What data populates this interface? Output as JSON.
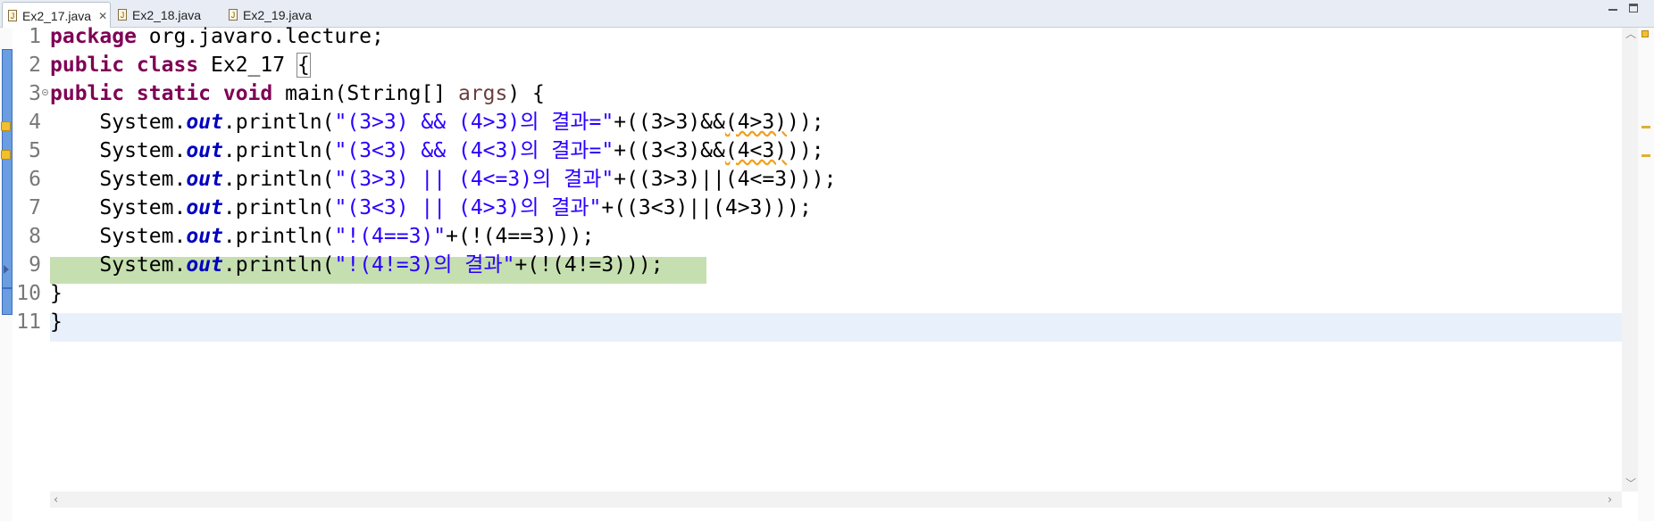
{
  "tabs": [
    {
      "label": "Ex2_17.java",
      "active": true,
      "close": "✕"
    },
    {
      "label": "Ex2_18.java",
      "active": false
    },
    {
      "label": "Ex2_19.java",
      "active": false
    }
  ],
  "line_numbers": [
    "1",
    "2",
    "3",
    "4",
    "5",
    "6",
    "7",
    "8",
    "9",
    "10",
    "11"
  ],
  "code": {
    "l1_kw": "package",
    "l1_rest": " org.javaro.lecture;",
    "l2_kw": "public class",
    "l2_rest": " Ex2_17 ",
    "l2_brace": "{",
    "l3_kw": "public static void",
    "l3_mid": " main(String[] ",
    "l3_param": "args",
    "l3_end": ") {",
    "l4_pre": "    System.",
    "l4_fld": "out",
    "l4_call": ".println(",
    "l4_str": "\"(3>3) && (4>3)의 결과=\"",
    "l4_tail1": "+((3>3)&&",
    "l4_squig": "(4>3)",
    "l4_tail2": "));",
    "l5_pre": "    System.",
    "l5_fld": "out",
    "l5_call": ".println(",
    "l5_str": "\"(3<3) && (4<3)의 결과=\"",
    "l5_tail1": "+((3<3)&&",
    "l5_squig": "(4<3)",
    "l5_tail2": "));",
    "l6_pre": "    System.",
    "l6_fld": "out",
    "l6_call": ".println(",
    "l6_str": "\"(3>3) || (4<=3)의 결과\"",
    "l6_tail": "+((3>3)||(4<=3)));",
    "l7_pre": "    System.",
    "l7_fld": "out",
    "l7_call": ".println(",
    "l7_str": "\"(3<3) || (4>3)의 결과\"",
    "l7_tail": "+((3<3)||(4>3)));",
    "l8_pre": "    System.",
    "l8_fld": "out",
    "l8_call": ".println(",
    "l8_str": "\"!(4==3)\"",
    "l8_tail": "+(!(4==3)));",
    "l9_pre": "    System.",
    "l9_fld": "out",
    "l9_call": ".println(",
    "l9_str": "\"!(4!=3)의 결과\"",
    "l9_tail": "+(!(4!=3)));",
    "l10": "}",
    "l11": "}"
  },
  "colors": {
    "keyword": "#7f0055",
    "string": "#2a00ff",
    "field": "#0000c0",
    "selection": "#c6dfb0",
    "current_line": "#e8f1fb"
  }
}
